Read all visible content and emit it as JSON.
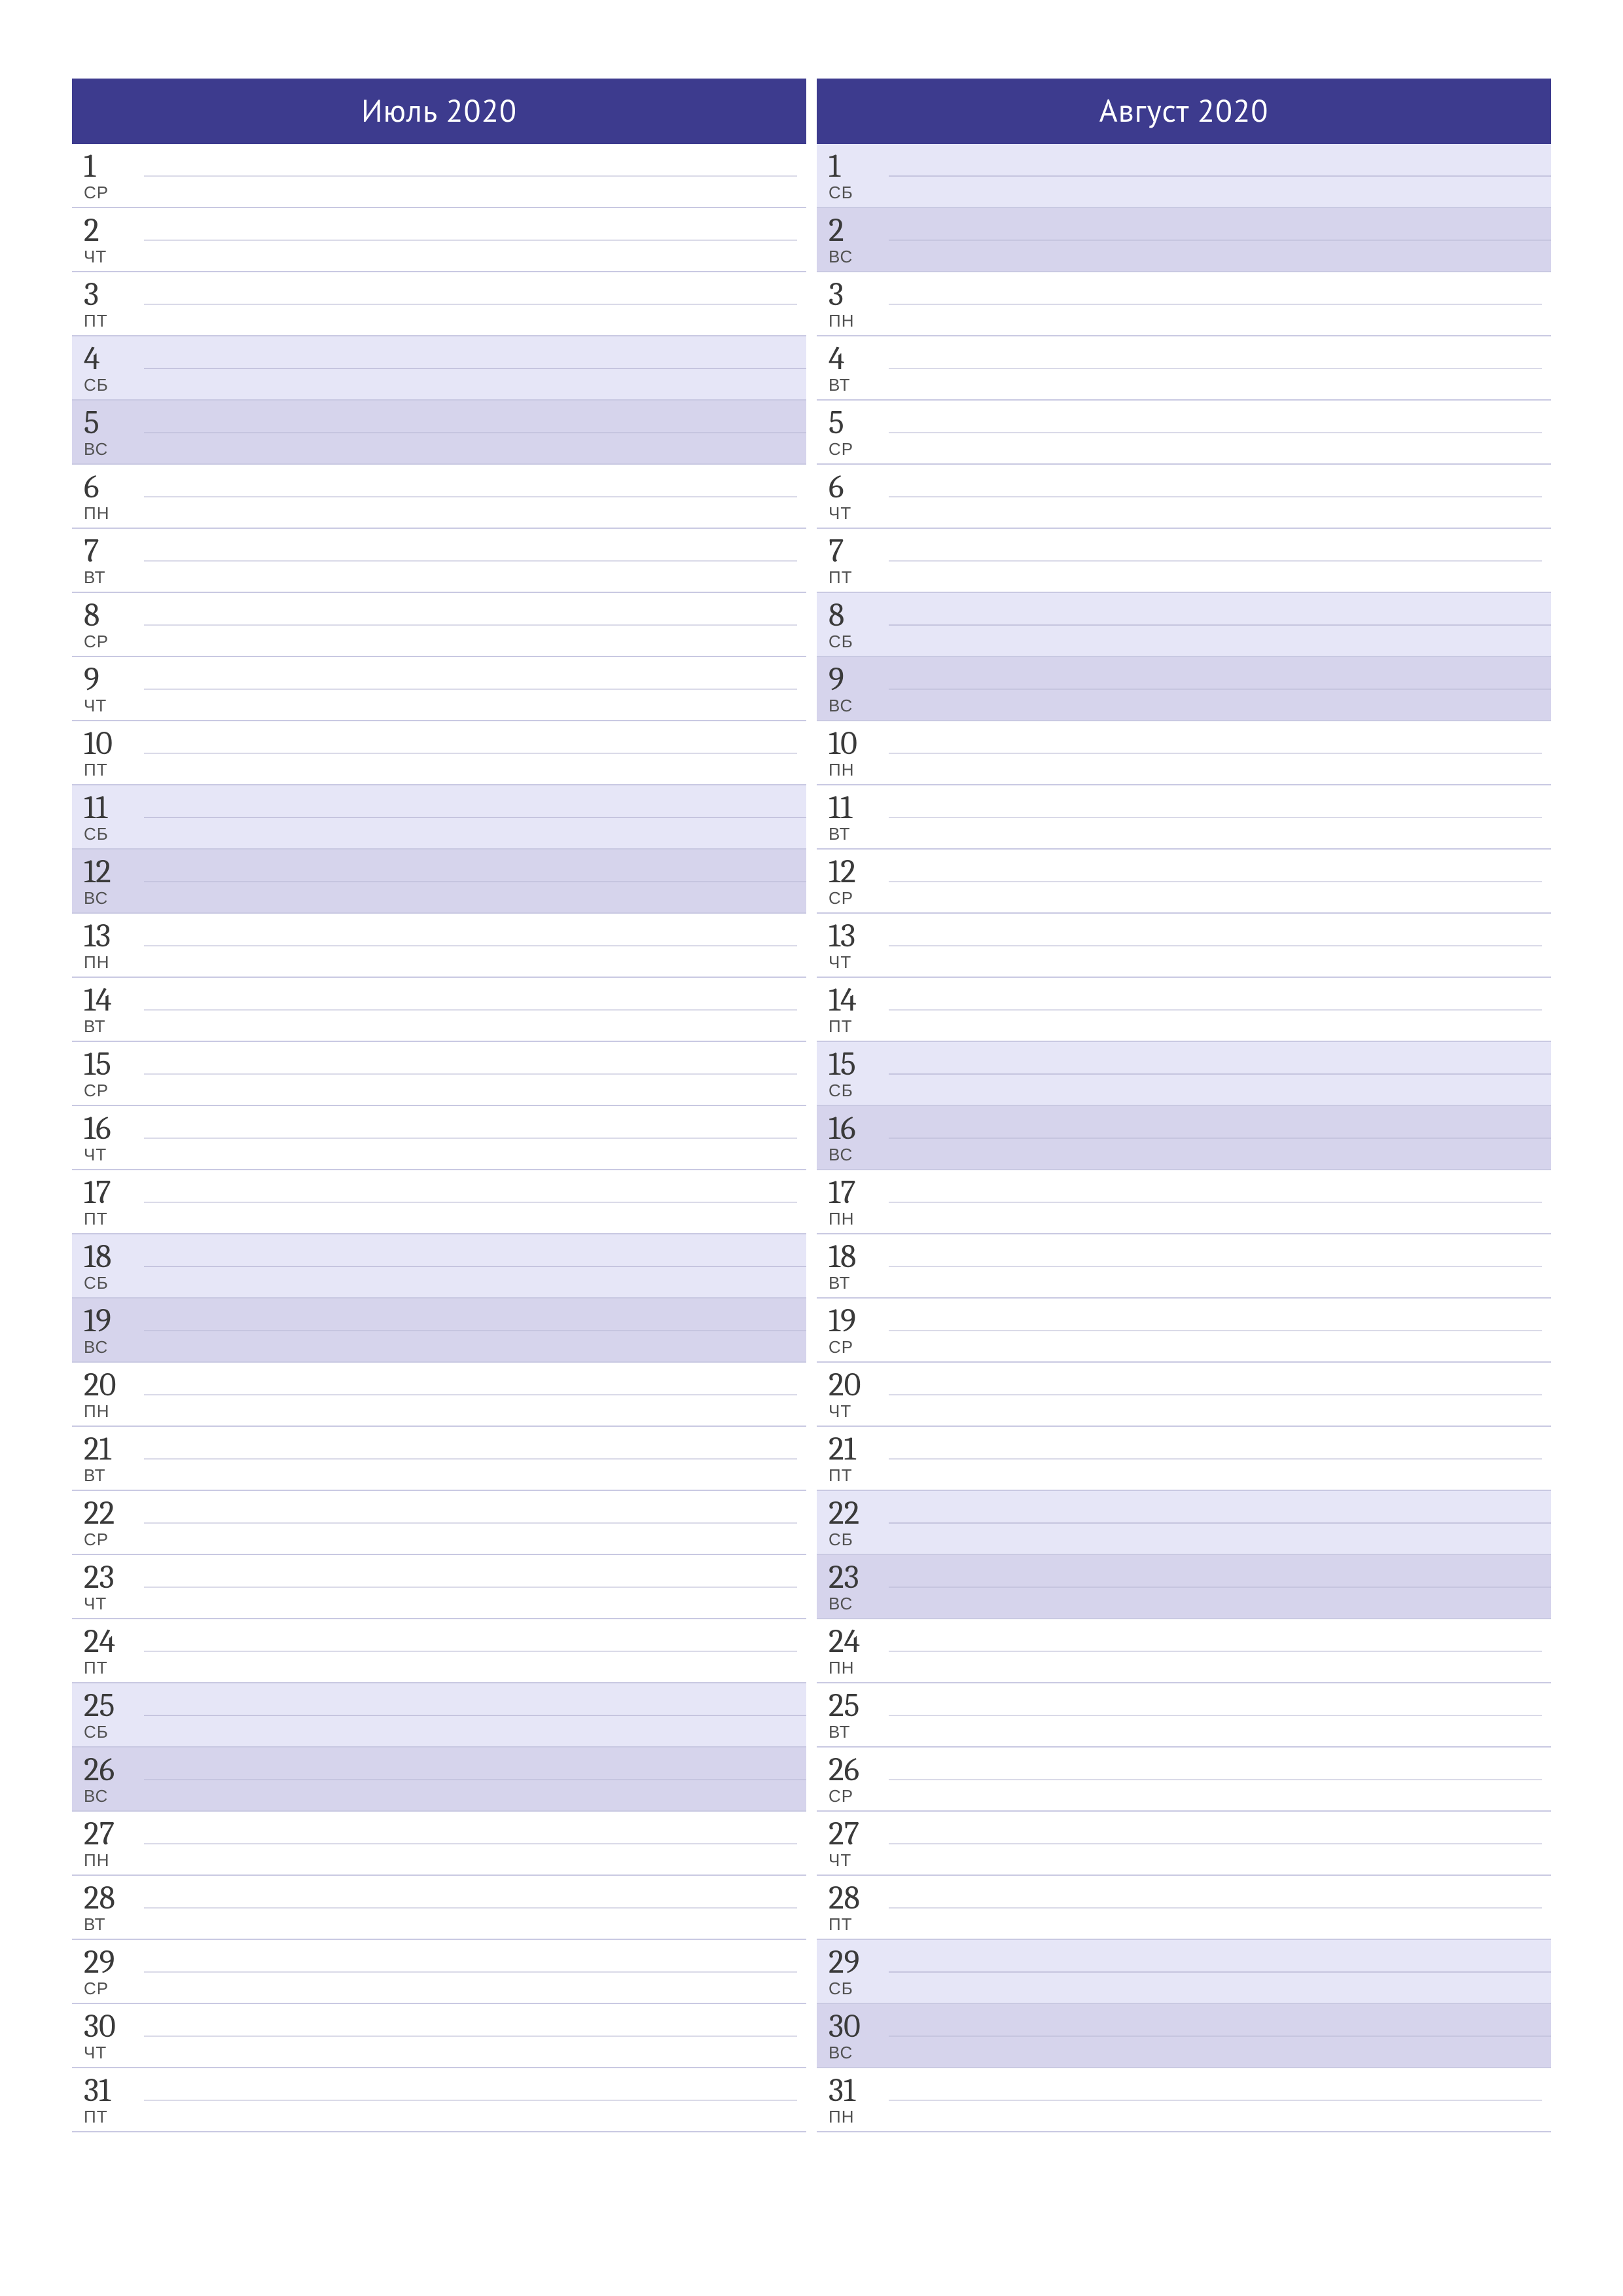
{
  "dow_labels": [
    "ПН",
    "ВТ",
    "СР",
    "ЧТ",
    "ПТ",
    "СБ",
    "ВС"
  ],
  "months": [
    {
      "title": "Июль 2020",
      "days": [
        {
          "n": 1,
          "dow": "СР",
          "t": "wd"
        },
        {
          "n": 2,
          "dow": "ЧТ",
          "t": "wd"
        },
        {
          "n": 3,
          "dow": "ПТ",
          "t": "wd"
        },
        {
          "n": 4,
          "dow": "СБ",
          "t": "sat"
        },
        {
          "n": 5,
          "dow": "ВС",
          "t": "sun"
        },
        {
          "n": 6,
          "dow": "ПН",
          "t": "wd"
        },
        {
          "n": 7,
          "dow": "ВТ",
          "t": "wd"
        },
        {
          "n": 8,
          "dow": "СР",
          "t": "wd"
        },
        {
          "n": 9,
          "dow": "ЧТ",
          "t": "wd"
        },
        {
          "n": 10,
          "dow": "ПТ",
          "t": "wd"
        },
        {
          "n": 11,
          "dow": "СБ",
          "t": "sat"
        },
        {
          "n": 12,
          "dow": "ВС",
          "t": "sun"
        },
        {
          "n": 13,
          "dow": "ПН",
          "t": "wd"
        },
        {
          "n": 14,
          "dow": "ВТ",
          "t": "wd"
        },
        {
          "n": 15,
          "dow": "СР",
          "t": "wd"
        },
        {
          "n": 16,
          "dow": "ЧТ",
          "t": "wd"
        },
        {
          "n": 17,
          "dow": "ПТ",
          "t": "wd"
        },
        {
          "n": 18,
          "dow": "СБ",
          "t": "sat"
        },
        {
          "n": 19,
          "dow": "ВС",
          "t": "sun"
        },
        {
          "n": 20,
          "dow": "ПН",
          "t": "wd"
        },
        {
          "n": 21,
          "dow": "ВТ",
          "t": "wd"
        },
        {
          "n": 22,
          "dow": "СР",
          "t": "wd"
        },
        {
          "n": 23,
          "dow": "ЧТ",
          "t": "wd"
        },
        {
          "n": 24,
          "dow": "ПТ",
          "t": "wd"
        },
        {
          "n": 25,
          "dow": "СБ",
          "t": "sat"
        },
        {
          "n": 26,
          "dow": "ВС",
          "t": "sun"
        },
        {
          "n": 27,
          "dow": "ПН",
          "t": "wd"
        },
        {
          "n": 28,
          "dow": "ВТ",
          "t": "wd"
        },
        {
          "n": 29,
          "dow": "СР",
          "t": "wd"
        },
        {
          "n": 30,
          "dow": "ЧТ",
          "t": "wd"
        },
        {
          "n": 31,
          "dow": "ПТ",
          "t": "wd"
        }
      ]
    },
    {
      "title": "Август 2020",
      "days": [
        {
          "n": 1,
          "dow": "СБ",
          "t": "sat"
        },
        {
          "n": 2,
          "dow": "ВС",
          "t": "sun"
        },
        {
          "n": 3,
          "dow": "ПН",
          "t": "wd"
        },
        {
          "n": 4,
          "dow": "ВТ",
          "t": "wd"
        },
        {
          "n": 5,
          "dow": "СР",
          "t": "wd"
        },
        {
          "n": 6,
          "dow": "ЧТ",
          "t": "wd"
        },
        {
          "n": 7,
          "dow": "ПТ",
          "t": "wd"
        },
        {
          "n": 8,
          "dow": "СБ",
          "t": "sat"
        },
        {
          "n": 9,
          "dow": "ВС",
          "t": "sun"
        },
        {
          "n": 10,
          "dow": "ПН",
          "t": "wd"
        },
        {
          "n": 11,
          "dow": "ВТ",
          "t": "wd"
        },
        {
          "n": 12,
          "dow": "СР",
          "t": "wd"
        },
        {
          "n": 13,
          "dow": "ЧТ",
          "t": "wd"
        },
        {
          "n": 14,
          "dow": "ПТ",
          "t": "wd"
        },
        {
          "n": 15,
          "dow": "СБ",
          "t": "sat"
        },
        {
          "n": 16,
          "dow": "ВС",
          "t": "sun"
        },
        {
          "n": 17,
          "dow": "ПН",
          "t": "wd"
        },
        {
          "n": 18,
          "dow": "ВТ",
          "t": "wd"
        },
        {
          "n": 19,
          "dow": "СР",
          "t": "wd"
        },
        {
          "n": 20,
          "dow": "ЧТ",
          "t": "wd"
        },
        {
          "n": 21,
          "dow": "ПТ",
          "t": "wd"
        },
        {
          "n": 22,
          "dow": "СБ",
          "t": "sat"
        },
        {
          "n": 23,
          "dow": "ВС",
          "t": "sun"
        },
        {
          "n": 24,
          "dow": "ПН",
          "t": "wd"
        },
        {
          "n": 25,
          "dow": "ВТ",
          "t": "wd"
        },
        {
          "n": 26,
          "dow": "СР",
          "t": "wd"
        },
        {
          "n": 27,
          "dow": "ЧТ",
          "t": "wd"
        },
        {
          "n": 28,
          "dow": "ПТ",
          "t": "wd"
        },
        {
          "n": 29,
          "dow": "СБ",
          "t": "sat"
        },
        {
          "n": 30,
          "dow": "ВС",
          "t": "sun"
        },
        {
          "n": 31,
          "dow": "ПН",
          "t": "wd"
        }
      ]
    }
  ]
}
